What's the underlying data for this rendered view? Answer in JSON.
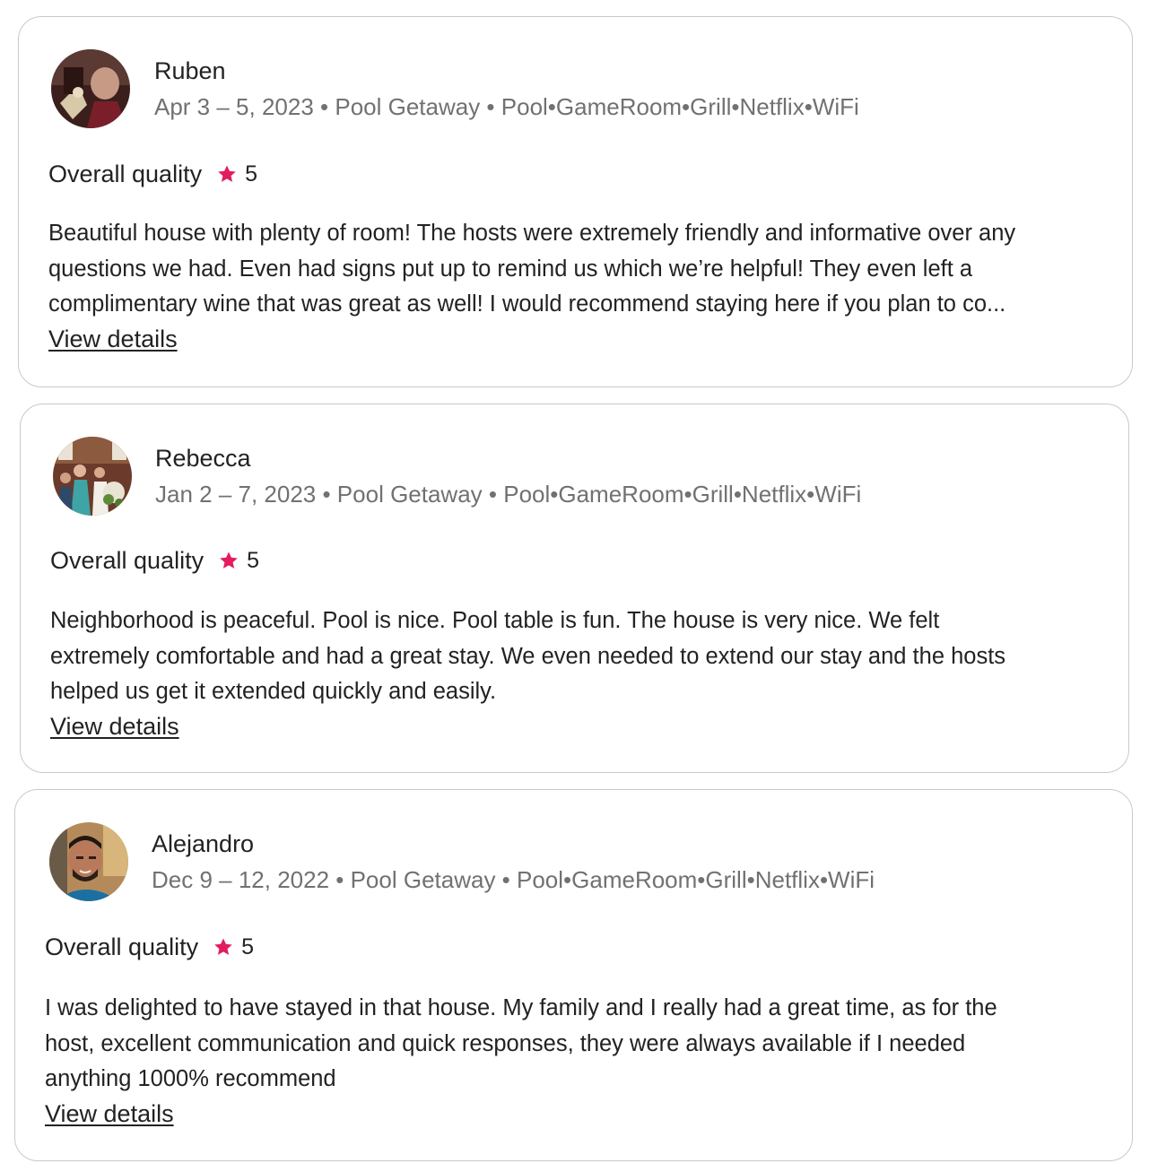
{
  "reviews": [
    {
      "name": "Ruben",
      "meta": "Apr 3 – 5, 2023 • Pool Getaway • Pool•GameRoom•Grill•Netflix•WiFi",
      "rating_label": "Overall quality",
      "rating_value": "5",
      "text_lines": [
        "Beautiful house with plenty of room! The hosts were extremely friendly and informative over any",
        "questions we had. Even had signs put up to remind us which we’re helpful! They even left a",
        "complimentary wine that was great as well! I would recommend staying here if you plan to co..."
      ],
      "link": "View details"
    },
    {
      "name": "Rebecca",
      "meta": "Jan 2 – 7, 2023 • Pool Getaway • Pool•GameRoom•Grill•Netflix•WiFi",
      "rating_label": "Overall quality",
      "rating_value": "5",
      "text_lines": [
        "Neighborhood is peaceful. Pool is nice. Pool table is fun. The house is very nice. We felt",
        "extremely comfortable and had a great stay. We even needed to extend our stay and the hosts",
        "helped us get it extended quickly and easily."
      ],
      "link": "View details"
    },
    {
      "name": "Alejandro",
      "meta": "Dec 9 – 12, 2022 • Pool Getaway • Pool•GameRoom•Grill•Netflix•WiFi",
      "rating_label": "Overall quality",
      "rating_value": "5",
      "text_lines": [
        "I was delighted to have stayed in that house. My family and I really had a great time, as for the",
        "host, excellent communication and quick responses, they were always available if I needed",
        "anything 1000% recommend"
      ],
      "link": "View details"
    }
  ],
  "icons": {
    "rating": "star-icon",
    "avatar": "avatar-photo"
  },
  "colors": {
    "star": "#e31c5f",
    "meta_text": "#717171",
    "body_text": "#222222",
    "card_border": "#c9c9c9"
  }
}
